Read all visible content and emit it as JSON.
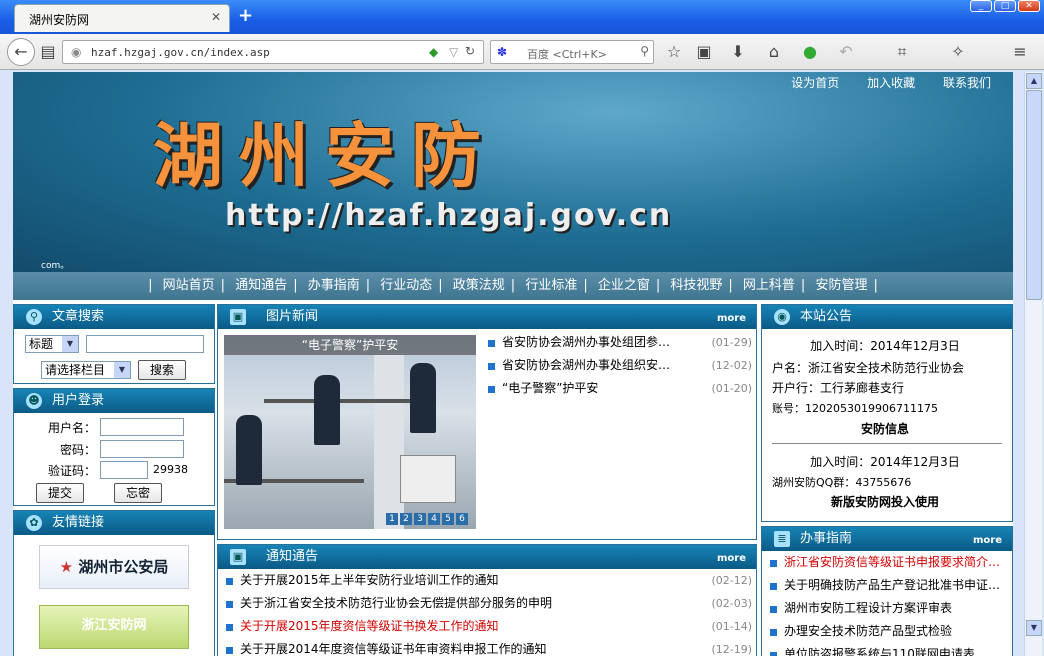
{
  "browser": {
    "tab_title": "湖州安防网",
    "new_tab": "+",
    "url": "hzaf.hzgaj.gov.cn/index.asp",
    "search_placeholder": "百度 <Ctrl+K>"
  },
  "header": {
    "top_links": [
      "设为首页",
      "加入收藏",
      "联系我们"
    ],
    "logo_text": "湖州安防",
    "site_url": "http://hzaf.hzgaj.gov.cn",
    "com_tag": "com。"
  },
  "nav": {
    "items": [
      "网站首页",
      "通知通告",
      "办事指南",
      "行业动态",
      "政策法规",
      "行业标准",
      "企业之窗",
      "科技视野",
      "网上科普",
      "安防管理"
    ]
  },
  "search_box": {
    "title": "文章搜索",
    "field_select": "标题",
    "column_select": "请选择栏目",
    "button": "搜索"
  },
  "login_box": {
    "title": "用户登录",
    "username_label": "用户名：",
    "password_label": "密码：",
    "captcha_label": "验证码：",
    "captcha_value": "29938",
    "submit": "提交",
    "forgot": "忘密"
  },
  "links_box": {
    "title": "友情链接",
    "logos": [
      "湖州市公安局",
      "浙江安防网"
    ]
  },
  "photo_news": {
    "title": "图片新闻",
    "more": "more",
    "caption": "“电子警察”护平安",
    "pager": [
      "1",
      "2",
      "3",
      "4",
      "5",
      "6"
    ],
    "items": [
      {
        "text": "省安防协会湖州办事处组团参…",
        "date": "(01-29)"
      },
      {
        "text": "省安防协会湖州办事处组织安…",
        "date": "(12-02)"
      },
      {
        "text": "“电子警察”护平安",
        "date": "(01-20)"
      }
    ]
  },
  "notices": {
    "title": "通知通告",
    "more": "more",
    "items": [
      {
        "text": "关于开展2015年上半年安防行业培训工作的通知",
        "date": "(02-12)",
        "red": false
      },
      {
        "text": "关于浙江省安全技术防范行业协会无偿提供部分服务的申明",
        "date": "(02-03)",
        "red": false
      },
      {
        "text": "关于开展2015年度资信等级证书换发工作的通知",
        "date": "(01-14)",
        "red": true
      },
      {
        "text": "关于开展2014年度资信等级证书年审资料申报工作的通知",
        "date": "(12-19)",
        "red": false
      }
    ]
  },
  "announcements": {
    "title": "本站公告",
    "first": {
      "time": "加入时间：2014年12月3日",
      "lines": [
        "户名：浙江省安全技术防范行业协会",
        "开户行：工行茅廊巷支行",
        "账号：1202053019906711175"
      ],
      "heading": "安防信息"
    },
    "second": {
      "time": "加入时间：2014年12月3日",
      "lines": [
        "湖州安防QQ群：43755676"
      ],
      "heading": "新版安防网投入使用"
    }
  },
  "guide": {
    "title": "办事指南",
    "more": "more",
    "items": [
      {
        "text": "浙江省安防资信等级证书申报要求简介…",
        "red": true
      },
      {
        "text": "关于明确技防产品生产登记批准书申证…",
        "red": false
      },
      {
        "text": "湖州市安防工程设计方案评审表",
        "red": false
      },
      {
        "text": "办理安全技术防范产品型式检验",
        "red": false
      },
      {
        "text": "单位防盗报警系统与110联网申请表",
        "red": false
      }
    ]
  }
}
